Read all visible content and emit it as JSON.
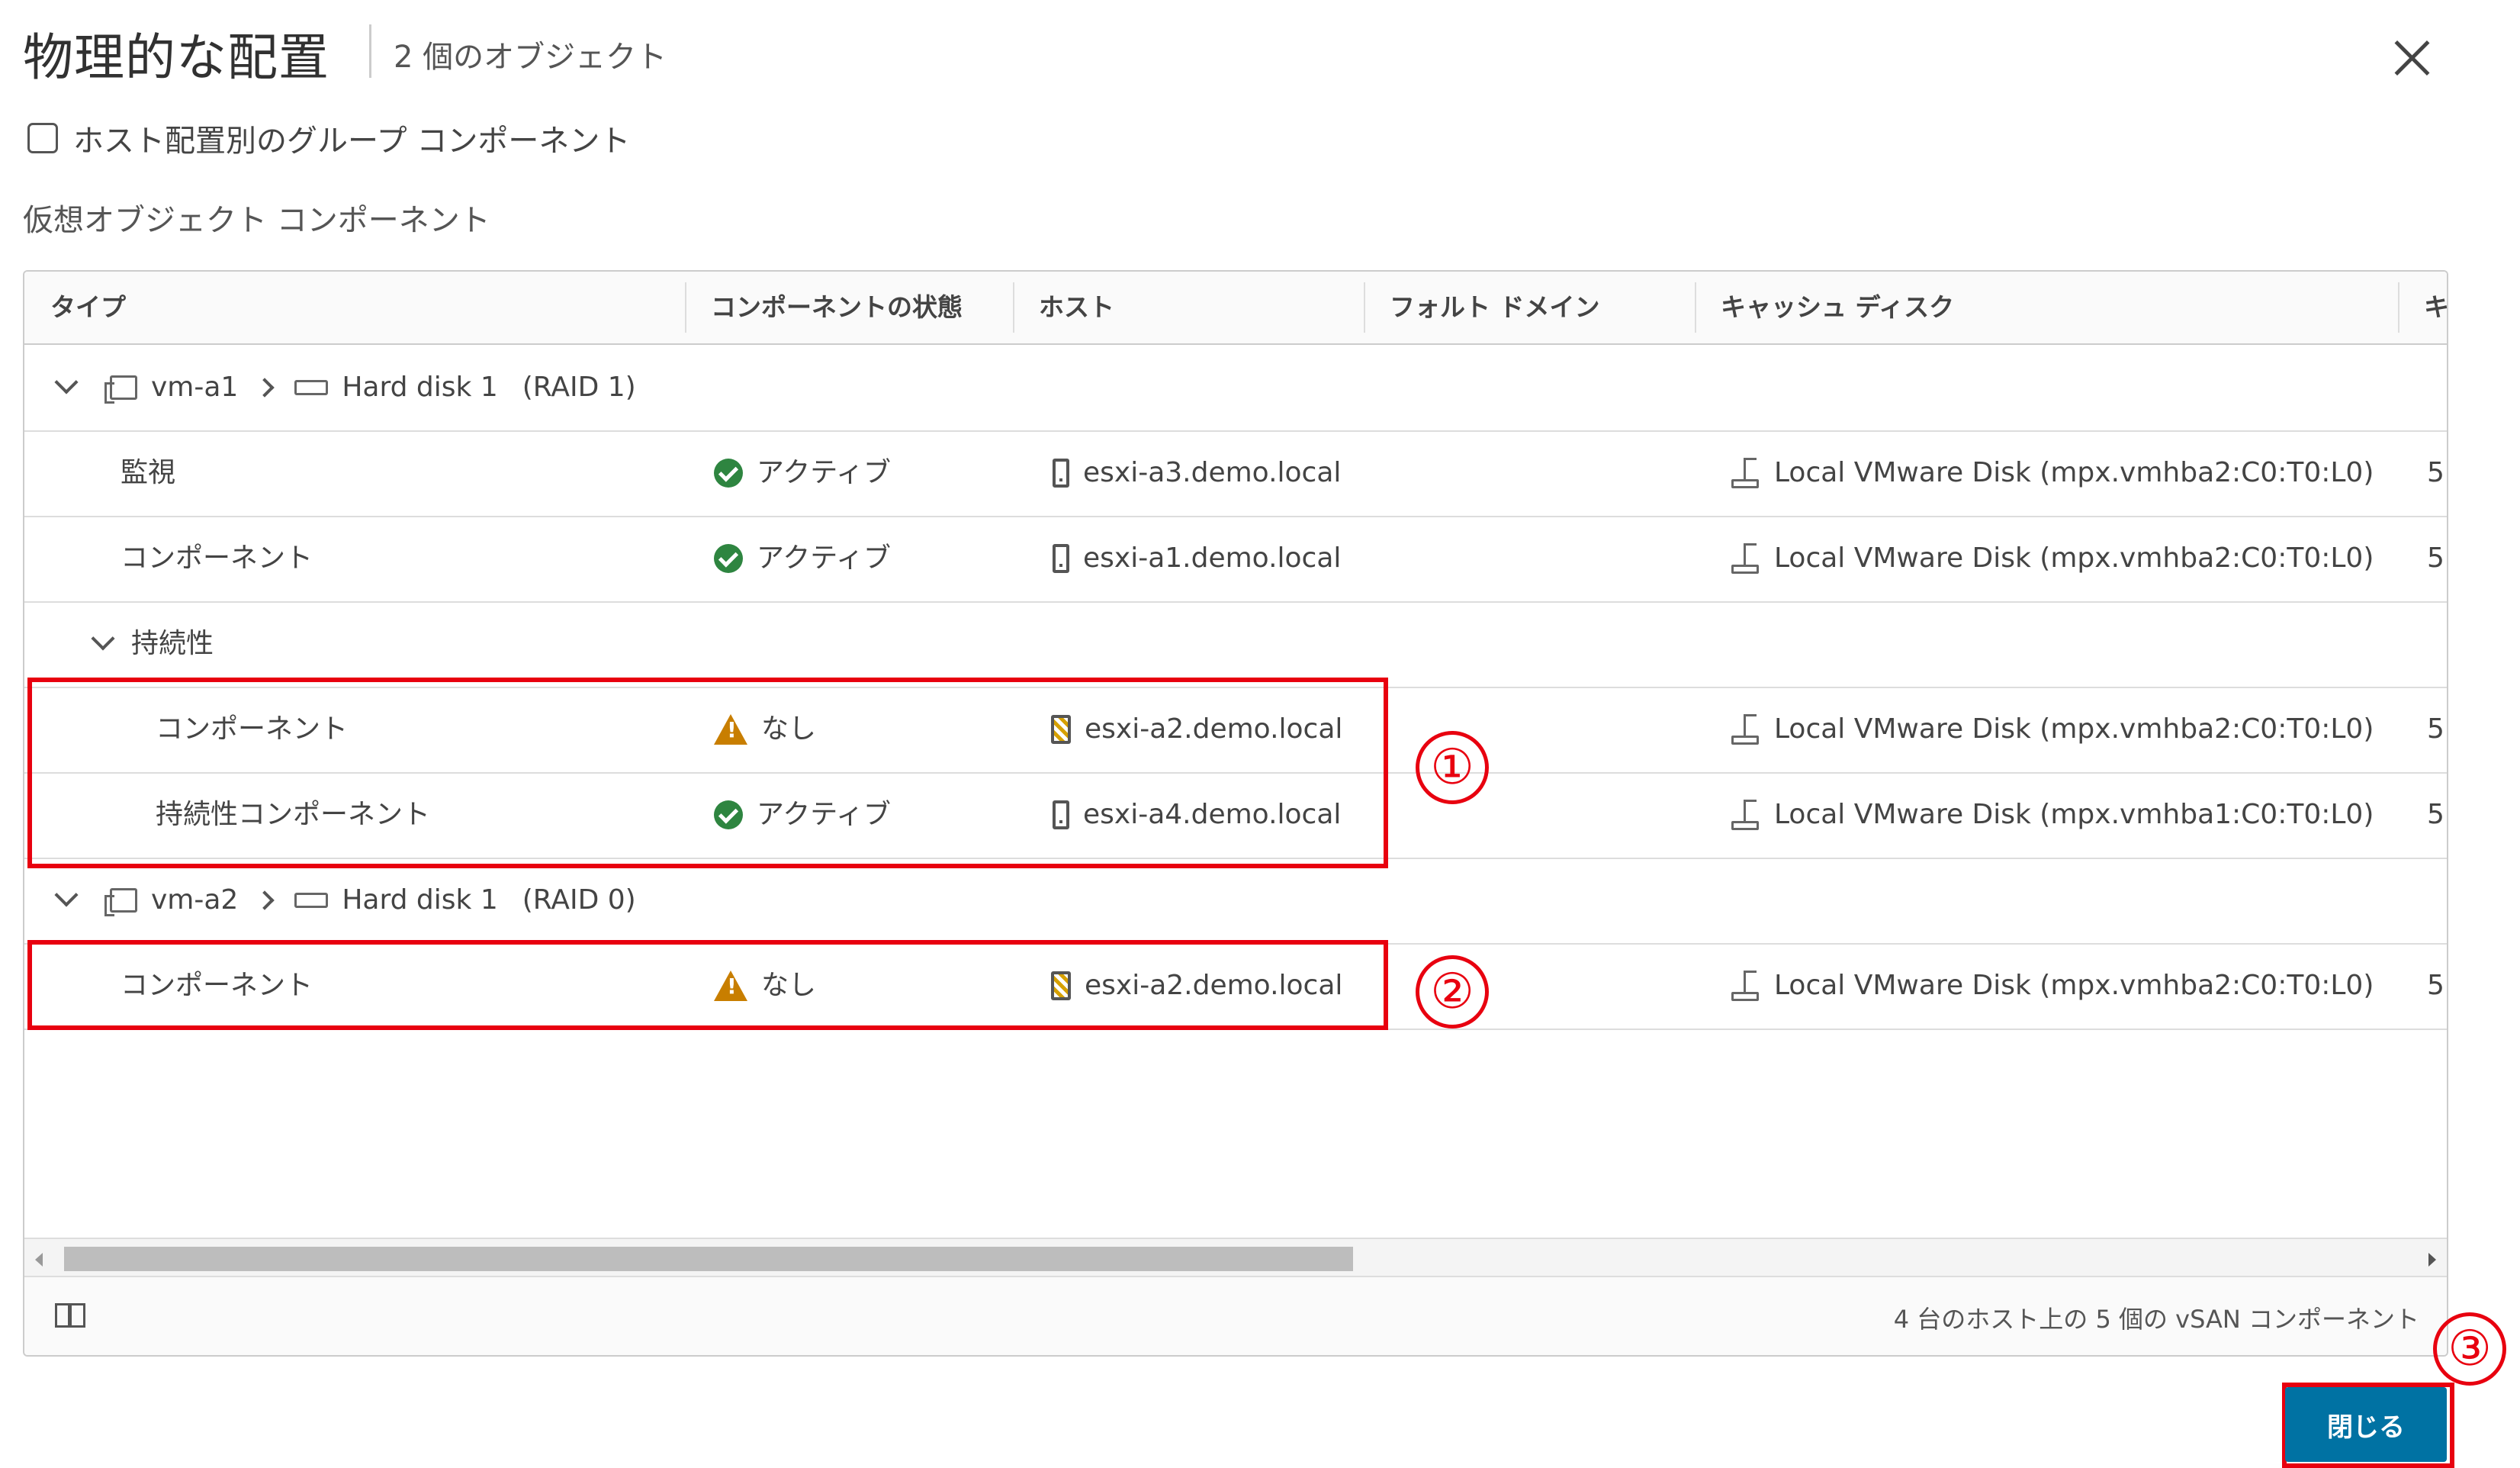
{
  "dialog": {
    "title": "物理的な配置",
    "subtitle": "2 個のオブジェクト",
    "group_checkbox_label": "ホスト配置別のグループ コンポーネント",
    "section_label": "仮想オブジェクト コンポーネント",
    "close_button": "閉じる"
  },
  "table": {
    "columns": [
      "タイプ",
      "コンポーネントの状態",
      "ホスト",
      "フォルト ドメイン",
      "キャッシュ ディスク",
      "キ"
    ],
    "groups": [
      {
        "vm": "vm-a1",
        "disk": "Hard disk 1",
        "raid": "(RAID 1)"
      },
      {
        "vm": "vm-a2",
        "disk": "Hard disk 1",
        "raid": "(RAID 0)"
      }
    ],
    "subgroup": "持続性",
    "rows": [
      {
        "type": "監視",
        "state": "アクティブ",
        "host": "esxi-a3.demo.local",
        "cache": "Local VMware Disk (mpx.vmhba2:C0:T0:L0)",
        "next": "5"
      },
      {
        "type": "コンポーネント",
        "state": "アクティブ",
        "host": "esxi-a1.demo.local",
        "cache": "Local VMware Disk (mpx.vmhba2:C0:T0:L0)",
        "next": "5"
      },
      {
        "type": "コンポーネント",
        "state": "なし",
        "host": "esxi-a2.demo.local",
        "cache": "Local VMware Disk (mpx.vmhba2:C0:T0:L0)",
        "next": "5"
      },
      {
        "type": "持続性コンポーネント",
        "state": "アクティブ",
        "host": "esxi-a4.demo.local",
        "cache": "Local VMware Disk (mpx.vmhba1:C0:T0:L0)",
        "next": "5"
      },
      {
        "type": "コンポーネント",
        "state": "なし",
        "host": "esxi-a2.demo.local",
        "cache": "Local VMware Disk (mpx.vmhba2:C0:T0:L0)",
        "next": "5"
      }
    ],
    "footer_count": "4 台のホスト上の 5 個の vSAN コンポーネント"
  },
  "annotations": [
    "①",
    "②",
    "③"
  ],
  "colors": {
    "accent": "#0072a3",
    "highlight": "#e8000f",
    "ok": "#2e8540",
    "warn": "#c87e00"
  }
}
